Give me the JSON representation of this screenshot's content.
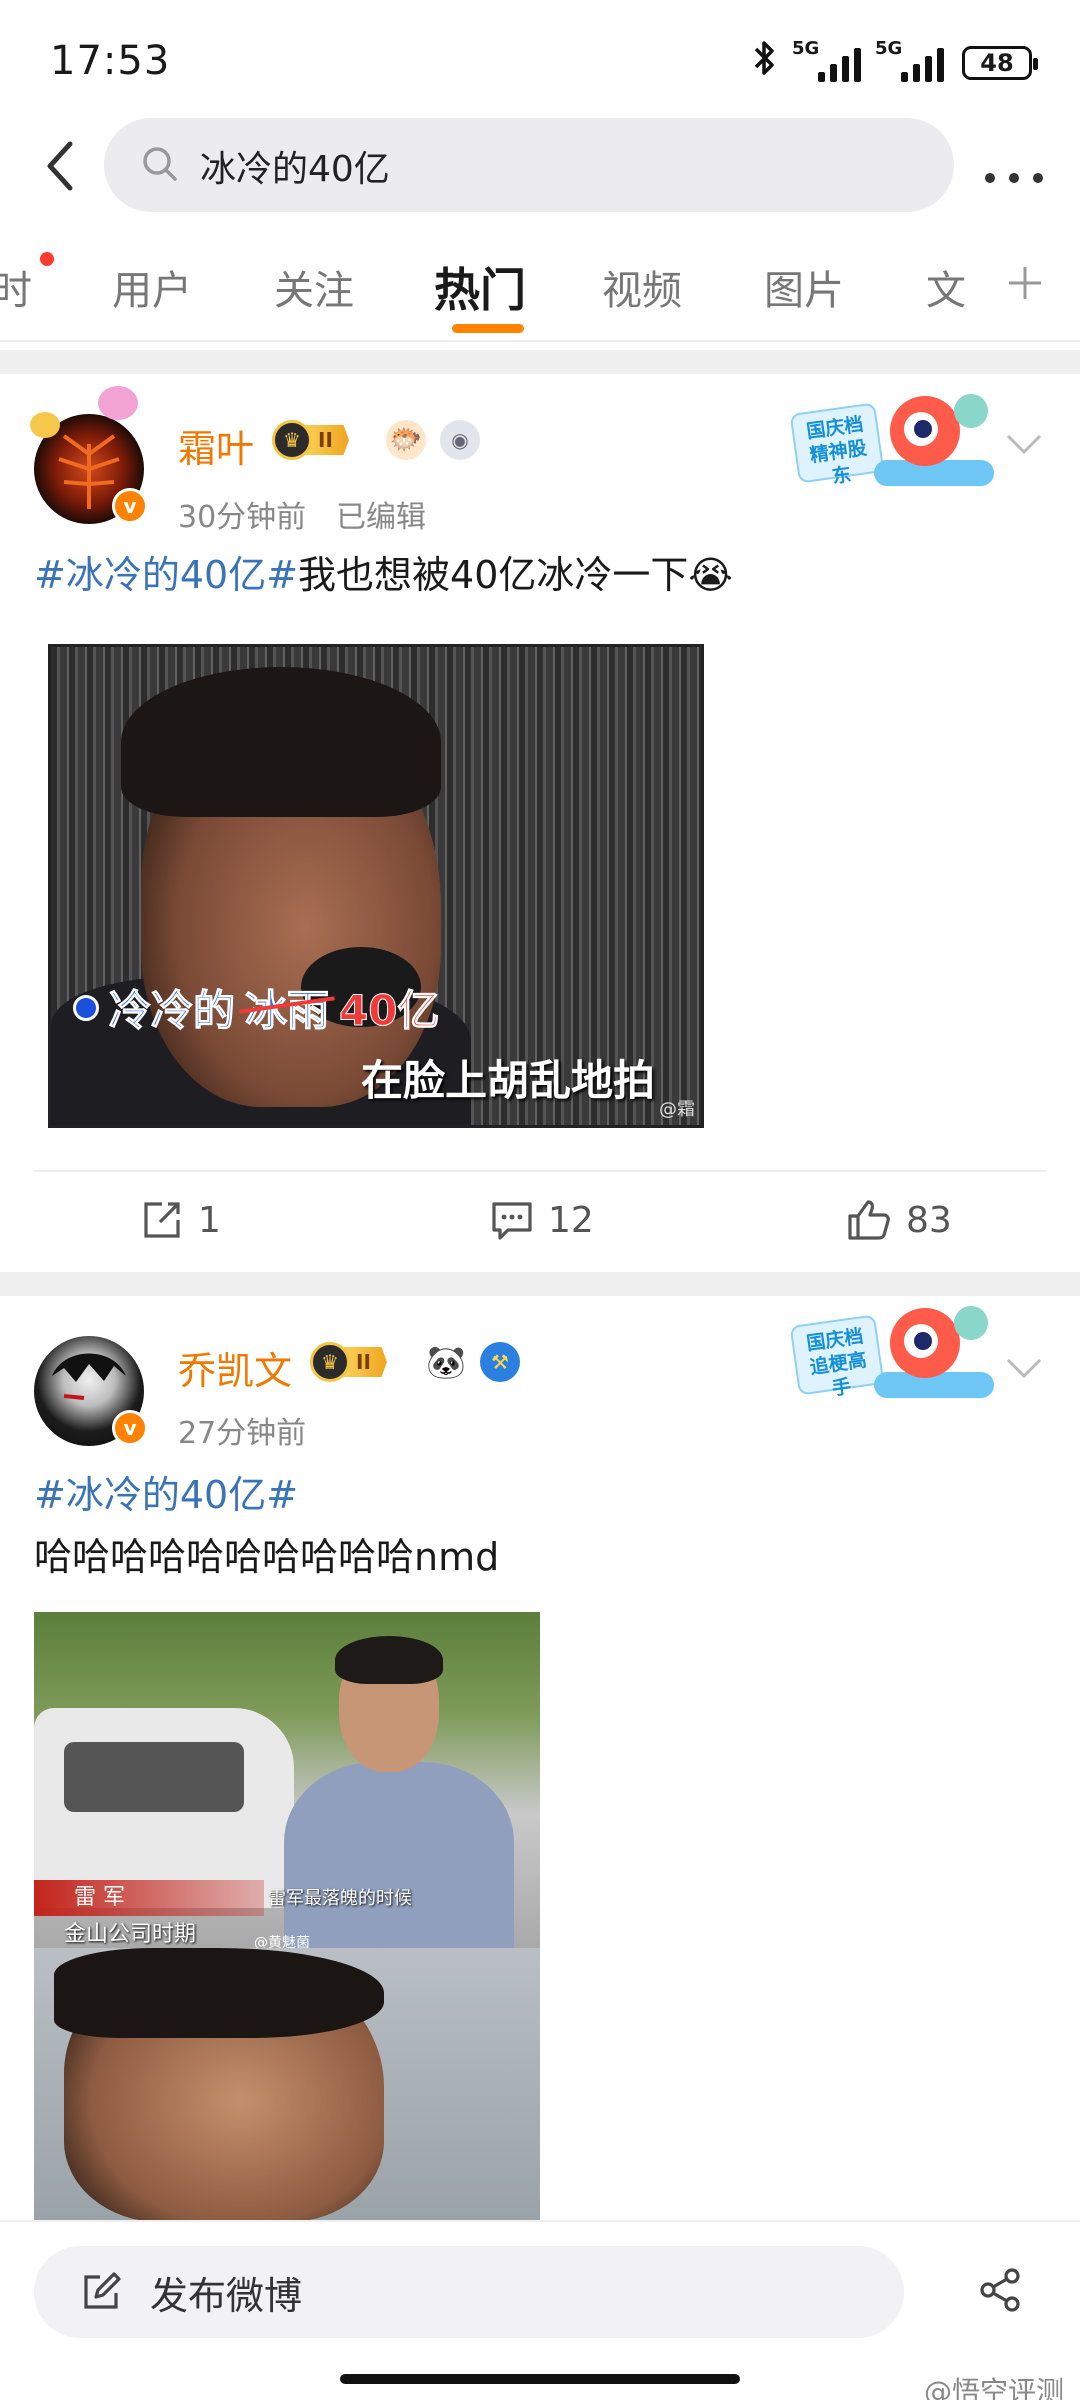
{
  "status_bar": {
    "time": "17:53",
    "network_1": "5G",
    "network_2": "5G",
    "battery": "48"
  },
  "search": {
    "query": "冰冷的40亿"
  },
  "tabs": [
    {
      "label": "时"
    },
    {
      "label": "用户"
    },
    {
      "label": "关注"
    },
    {
      "label": "热门"
    },
    {
      "label": "视频"
    },
    {
      "label": "图片"
    },
    {
      "label": "文"
    }
  ],
  "posts": [
    {
      "username": "霜叶",
      "level": "II",
      "meta_time": "30分钟前",
      "meta_edit": "已编辑",
      "promo_badge": "国庆档精神股东",
      "hashtag": "#冰冷的40亿#",
      "text": "我也想被40亿冰冷一下",
      "emoji": "😭",
      "image_captions": {
        "line1_a": "冷冷的",
        "line1_struck": "冰雨",
        "line1_red": "40亿",
        "line2": "在脸上胡乱地拍",
        "watermark": "@霜"
      },
      "reposts": "1",
      "comments": "12",
      "likes": "83"
    },
    {
      "username": "乔凯文",
      "level": "II",
      "meta_time": "27分钟前",
      "promo_badge": "国庆档追梗高手",
      "hashtag": "#冰冷的40亿#",
      "text": "哈哈哈哈哈哈哈哈哈哈nmd",
      "image_captions": {
        "name": "雷 军",
        "subtitle": "金山公司时期",
        "caption": "雷军最落魄的时候",
        "watermark": "@黄魅菌"
      }
    }
  ],
  "bottom": {
    "compose_label": "发布微博",
    "watermark": "@悟空评测"
  },
  "colors": {
    "accent": "#ff8200",
    "hashtag": "#3b74b6",
    "username": "#f07800"
  }
}
